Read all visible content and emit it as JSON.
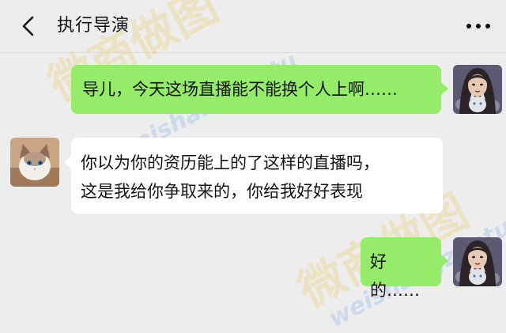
{
  "header": {
    "title": "执行导演"
  },
  "messages": [
    {
      "side": "right",
      "text": "导儿，今天这场直播能不能换个人上啊……"
    },
    {
      "side": "left",
      "line1": "你以为你的资历能上的了这样的直播吗，",
      "line2": "这是我给你争取来的，你给我好好表现"
    },
    {
      "side": "right",
      "text": "好的……"
    }
  ],
  "watermark": {
    "cn": "微商做图",
    "en": "weishangzuotu"
  },
  "colors": {
    "background": "#ededed",
    "sent_bubble": "#95ec69",
    "received_bubble": "#ffffff"
  }
}
